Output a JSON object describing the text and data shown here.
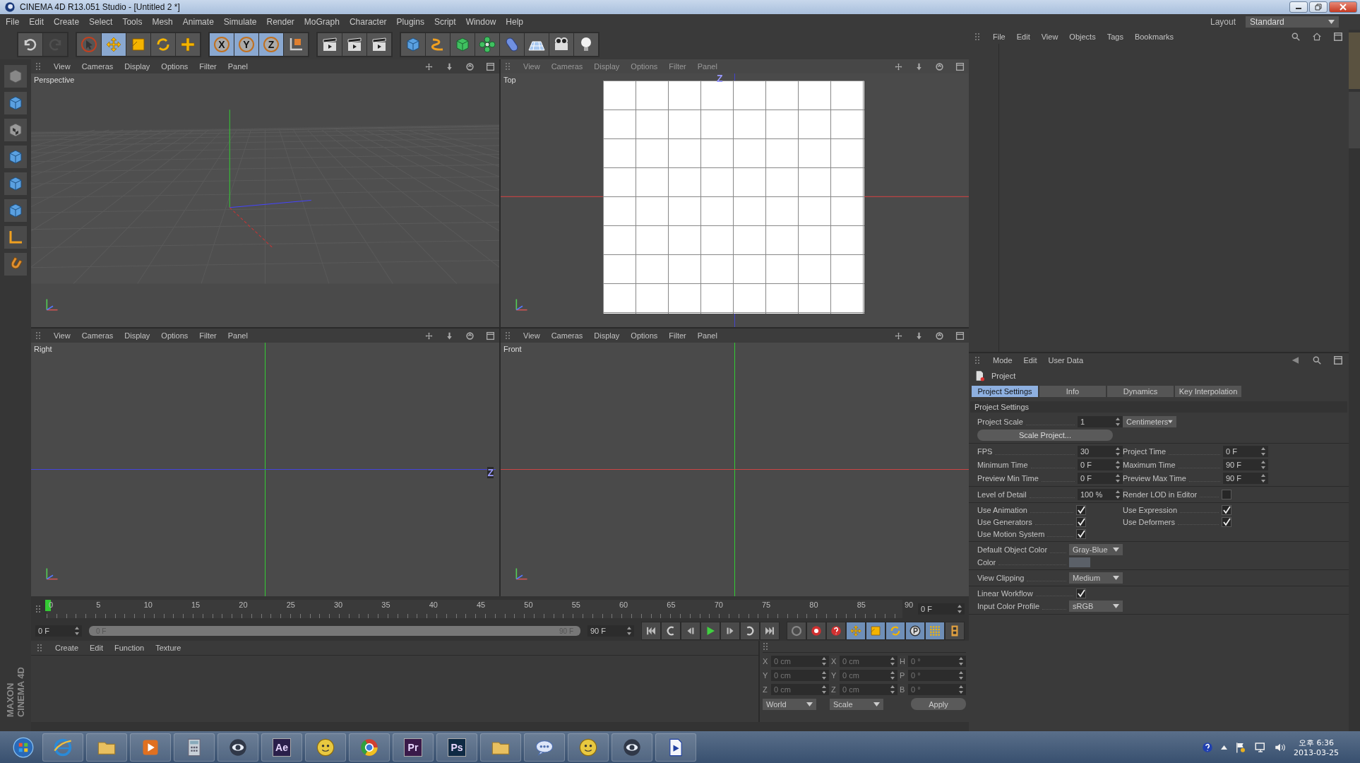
{
  "window": {
    "title": "CINEMA 4D R13.051 Studio - [Untitled 2 *]"
  },
  "menu": [
    "File",
    "Edit",
    "Create",
    "Select",
    "Tools",
    "Mesh",
    "Animate",
    "Simulate",
    "Render",
    "MoGraph",
    "Character",
    "Plugins",
    "Script",
    "Window",
    "Help"
  ],
  "layout": {
    "label": "Layout",
    "value": "Standard"
  },
  "toolbar": [
    {
      "items": [
        {
          "kind": "undo",
          "selected": false,
          "disabled": false
        },
        {
          "kind": "redo",
          "selected": false,
          "disabled": true
        }
      ]
    },
    {
      "items": [
        {
          "kind": "cursor",
          "selected": false,
          "disabled": false
        },
        {
          "kind": "move",
          "selected": true,
          "disabled": false
        },
        {
          "kind": "scale",
          "selected": false,
          "disabled": false
        },
        {
          "kind": "rotate",
          "selected": false,
          "disabled": false
        },
        {
          "kind": "plus",
          "selected": false,
          "disabled": false
        }
      ]
    },
    {
      "items": [
        {
          "kind": "axis",
          "label": "X",
          "selected": true,
          "disabled": false
        },
        {
          "kind": "axis",
          "label": "Y",
          "selected": true,
          "disabled": false
        },
        {
          "kind": "axis",
          "label": "Z",
          "selected": true,
          "disabled": false
        },
        {
          "kind": "coordinate-system",
          "selected": false,
          "disabled": false
        }
      ]
    },
    {
      "items": [
        {
          "kind": "clapperboard",
          "selected": false,
          "disabled": false
        },
        {
          "kind": "clapperboard",
          "selected": false,
          "disabled": false
        },
        {
          "kind": "clapperboard",
          "selected": false,
          "disabled": false
        }
      ]
    },
    {
      "items": [
        {
          "kind": "cube",
          "selected": false,
          "disabled": false
        },
        {
          "kind": "spline",
          "selected": false,
          "disabled": false
        },
        {
          "kind": "subdivision-cube",
          "selected": false,
          "disabled": false
        },
        {
          "kind": "flower",
          "selected": false,
          "disabled": false
        },
        {
          "kind": "capsule",
          "selected": false,
          "disabled": false
        },
        {
          "kind": "floor",
          "selected": false,
          "disabled": false
        },
        {
          "kind": "camera",
          "selected": false,
          "disabled": false
        },
        {
          "kind": "light-bulb",
          "selected": false,
          "disabled": false
        }
      ]
    }
  ],
  "left_tools": [
    {
      "kind": "make-editable"
    },
    {
      "kind": "cube"
    },
    {
      "kind": "checker"
    },
    {
      "kind": "cube"
    },
    {
      "kind": "cube"
    },
    {
      "kind": "cube"
    },
    {
      "kind": "corner"
    },
    {
      "kind": "magnet"
    }
  ],
  "logo": {
    "line_1": "MAXON",
    "line_2": "CINEMA 4D"
  },
  "viewports": [
    {
      "name": "Perspective",
      "kind": "perspective",
      "selected": false,
      "menu": [
        "View",
        "Cameras",
        "Display",
        "Options",
        "Filter",
        "Panel"
      ]
    },
    {
      "name": "Top",
      "kind": "top",
      "selected": true,
      "axis_label": "Z",
      "menu": [
        "View",
        "Cameras",
        "Display",
        "Options",
        "Filter",
        "Panel"
      ]
    },
    {
      "name": "Right",
      "kind": "right",
      "selected": false,
      "axis_label": "Z",
      "menu": [
        "View",
        "Cameras",
        "Display",
        "Options",
        "Filter",
        "Panel"
      ]
    },
    {
      "name": "Front",
      "kind": "front",
      "selected": false,
      "menu": [
        "View",
        "Cameras",
        "Display",
        "Options",
        "Filter",
        "Panel"
      ]
    }
  ],
  "timeline": {
    "ticks": [
      "0",
      "5",
      "10",
      "15",
      "20",
      "25",
      "30",
      "35",
      "40",
      "45",
      "50",
      "55",
      "60",
      "65",
      "70",
      "75",
      "80",
      "85",
      "90"
    ],
    "current": "0 F",
    "level": 0
  },
  "playback": {
    "start": "0 F",
    "range": {
      "start": "0 F",
      "end": "90 F",
      "level": 1
    },
    "end": "90 F",
    "buttons": [
      {
        "kind": "skip-start"
      },
      {
        "kind": "previous-key"
      },
      {
        "kind": "previous-frame"
      },
      {
        "kind": "play"
      },
      {
        "kind": "next-frame"
      },
      {
        "kind": "next-key"
      },
      {
        "kind": "skip-end"
      }
    ],
    "key_buttons": [
      {
        "kind": "autokey",
        "selected": false
      },
      {
        "kind": "record",
        "selected": false
      },
      {
        "kind": "question",
        "selected": false
      },
      {
        "kind": "move",
        "selected": true
      },
      {
        "kind": "scale",
        "selected": true
      },
      {
        "kind": "rotate",
        "selected": true
      },
      {
        "kind": "parameter",
        "selected": true
      },
      {
        "kind": "dots",
        "selected": true
      },
      {
        "kind": "film",
        "selected": false
      }
    ]
  },
  "materials": {
    "menu": [
      "Create",
      "Edit",
      "Function",
      "Texture"
    ]
  },
  "coordinates": {
    "rows": [
      {
        "axis_1": "X",
        "position": "0 cm",
        "axis_2": "X",
        "size": "0 cm",
        "axis_3": "H",
        "rotation": "0 °"
      },
      {
        "axis_1": "Y",
        "position": "0 cm",
        "axis_2": "Y",
        "size": "0 cm",
        "axis_3": "P",
        "rotation": "0 °"
      },
      {
        "axis_1": "Z",
        "position": "0 cm",
        "axis_2": "Z",
        "size": "0 cm",
        "axis_3": "B",
        "rotation": "0 °"
      }
    ],
    "mode": "World",
    "scale_mode": "Scale",
    "apply": "Apply"
  },
  "object_manager": {
    "menu": [
      "File",
      "Edit",
      "View",
      "Objects",
      "Tags",
      "Bookmarks"
    ]
  },
  "attributes": {
    "menu": [
      "Mode",
      "Edit",
      "User Data"
    ],
    "title": "Project",
    "tabs": [
      {
        "label": "Project Settings",
        "selected": true
      },
      {
        "label": "Info",
        "selected": false
      },
      {
        "label": "Dynamics",
        "selected": false
      },
      {
        "label": "Key Interpolation",
        "selected": false
      }
    ],
    "section": "Project Settings",
    "groups": [
      {
        "rows": [
          [
            {
              "kind": "number",
              "label": "Project Scale",
              "value": "1"
            },
            {
              "kind": "dropdown",
              "value": "Centimeters"
            }
          ],
          [
            {
              "kind": "button",
              "label": "Scale Project..."
            }
          ]
        ]
      },
      {
        "rows": [
          [
            {
              "kind": "number",
              "label": "FPS",
              "value": "30"
            },
            {
              "kind": "number",
              "label": "Project Time",
              "value": "0 F"
            }
          ],
          [
            {
              "kind": "number",
              "label": "Minimum Time",
              "value": "0 F"
            },
            {
              "kind": "number",
              "label": "Maximum Time",
              "value": "90 F"
            }
          ],
          [
            {
              "kind": "number",
              "label": "Preview Min Time",
              "value": "0 F"
            },
            {
              "kind": "number",
              "label": "Preview Max Time",
              "value": "90 F"
            }
          ]
        ]
      },
      {
        "rows": [
          [
            {
              "kind": "number",
              "label": "Level of Detail",
              "value": "100 %"
            },
            {
              "kind": "check",
              "label": "Render LOD in Editor",
              "checked": false
            }
          ]
        ]
      },
      {
        "rows": [
          [
            {
              "kind": "check",
              "label": "Use Animation",
              "checked": true
            },
            {
              "kind": "check",
              "label": "Use Expression",
              "checked": true
            }
          ],
          [
            {
              "kind": "check",
              "label": "Use Generators",
              "checked": true
            },
            {
              "kind": "check",
              "label": "Use Deformers",
              "checked": true
            }
          ],
          [
            {
              "kind": "check",
              "label": "Use Motion System",
              "checked": true
            }
          ]
        ]
      },
      {
        "rows": [
          [
            {
              "kind": "dropdown",
              "label": "Default Object Color",
              "value": "Gray-Blue"
            }
          ],
          [
            {
              "kind": "color",
              "label": "Color",
              "color": "#5b6068"
            }
          ]
        ]
      },
      {
        "rows": [
          [
            {
              "kind": "dropdown",
              "label": "View Clipping",
              "value": "Medium"
            }
          ]
        ]
      },
      {
        "rows": [
          [
            {
              "kind": "check",
              "label": "Linear Workflow",
              "checked": true
            }
          ],
          [
            {
              "kind": "dropdown",
              "label": "Input Color Profile",
              "value": "sRGB"
            }
          ]
        ]
      }
    ]
  },
  "taskbar": {
    "apps": [
      {
        "kind": "globe"
      },
      {
        "kind": "folder"
      },
      {
        "kind": "play"
      },
      {
        "kind": "calculator"
      },
      {
        "kind": "eye"
      },
      {
        "kind": "letters",
        "label": "Ae",
        "color": "#2a1f4a"
      },
      {
        "kind": "face"
      },
      {
        "kind": "wheel"
      },
      {
        "kind": "letters",
        "label": "Pr",
        "color": "#3a1a4a"
      },
      {
        "kind": "letters",
        "label": "Ps",
        "color": "#0e2a44"
      },
      {
        "kind": "folder"
      },
      {
        "kind": "chat"
      },
      {
        "kind": "face"
      },
      {
        "kind": "eye"
      },
      {
        "kind": "document"
      }
    ],
    "time": "오후 6:36",
    "date": "2013-03-25"
  }
}
